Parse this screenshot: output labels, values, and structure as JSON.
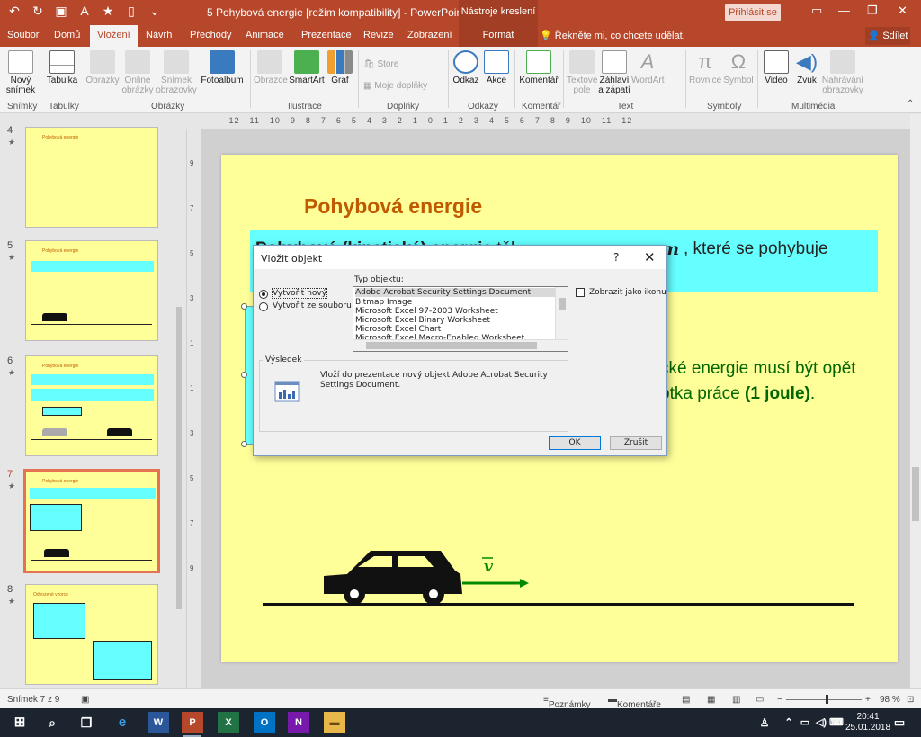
{
  "window": {
    "title": "5 Pohybová energie [režim kompatibility]  -  PowerPoint",
    "tools_tab": "Nástroje kreslení",
    "signin": "Přihlásit se"
  },
  "tabs": [
    "Soubor",
    "Domů",
    "Vložení",
    "Návrh",
    "Přechody",
    "Animace",
    "Prezentace",
    "Revize",
    "Zobrazení"
  ],
  "format_tab": "Formát",
  "tellme": "Řekněte mi, co chcete udělat.",
  "share": "Sdílet",
  "ribbon": {
    "new_slide": "Nový snímek",
    "table": "Tabulka",
    "pictures": "Obrázky",
    "online_pictures": "Online obrázky",
    "screenshot": "Snímek obrazovky",
    "album": "Fotoalbum",
    "shapes": "Obrazce",
    "smartart": "SmartArt",
    "chart": "Graf",
    "store": "Store",
    "my_addins": "Moje doplňky",
    "link": "Odkaz",
    "action": "Akce",
    "comment": "Komentář",
    "textbox": "Textové pole",
    "header": "Záhlaví a zápatí",
    "wordart": "WordArt",
    "equation": "Rovnice",
    "symbol": "Symbol",
    "video": "Video",
    "audio": "Zvuk",
    "screen_rec": "Nahrávání obrazovky",
    "groups": {
      "slides": "Snímky",
      "tables": "Tabulky",
      "images": "Obrázky",
      "illustrations": "Ilustrace",
      "addins": "Doplňky",
      "links": "Odkazy",
      "comments": "Komentář",
      "text": "Text",
      "symbols": "Symboly",
      "media": "Multimédia"
    }
  },
  "thumbnails": [
    {
      "num": "4",
      "title": "Pohybová energie"
    },
    {
      "num": "5",
      "title": "Pohybová energie"
    },
    {
      "num": "6",
      "title": "Pohybová energie"
    },
    {
      "num": "7",
      "title": "Pohybová energie"
    },
    {
      "num": "8",
      "title": "Odvozené vzorce"
    }
  ],
  "slide": {
    "title": "Pohybová energie",
    "cyan_text_bold": "Pohybová (kinetická) energie",
    "cyan_text_mid": " těl",
    "cyan_m": "m",
    "cyan_text_end": " , které se pohybuje",
    "green_line1": "cké energie musí být opět",
    "green_line2_pre": "otka práce ",
    "green_line2_bold": "(1 joule)",
    "green_line2_end": ".",
    "velocity_label": "v"
  },
  "dialog": {
    "title": "Vložit objekt",
    "help": "?",
    "create_new": "Vytvořit nový",
    "from_file": "Vytvořit ze souboru",
    "type_label": "Typ objektu:",
    "object_types": [
      "Adobe Acrobat Security Settings Document",
      "Bitmap Image",
      "Microsoft Excel 97-2003 Worksheet",
      "Microsoft Excel Binary Worksheet",
      "Microsoft Excel Chart",
      "Microsoft Excel Macro-Enabled Worksheet"
    ],
    "show_as_icon": "Zobrazit jako ikonu",
    "result_label": "Výsledek",
    "result_text": "Vloží do prezentace nový objekt Adobe Acrobat Security Settings Document.",
    "ok": "OK",
    "cancel": "Zrušit"
  },
  "status": {
    "slide_info": "Snímek 7 z 9",
    "notes": "Poznámky",
    "comments": "Komentáře",
    "zoom": "98 %"
  },
  "clock": {
    "time": "20:41",
    "date": "25.01.2018"
  },
  "colors": {
    "accent": "#b7472a",
    "slide_bg": "#ffff99",
    "cyan": "#66ffff",
    "title_orange": "#c05a00",
    "green": "#006600"
  }
}
